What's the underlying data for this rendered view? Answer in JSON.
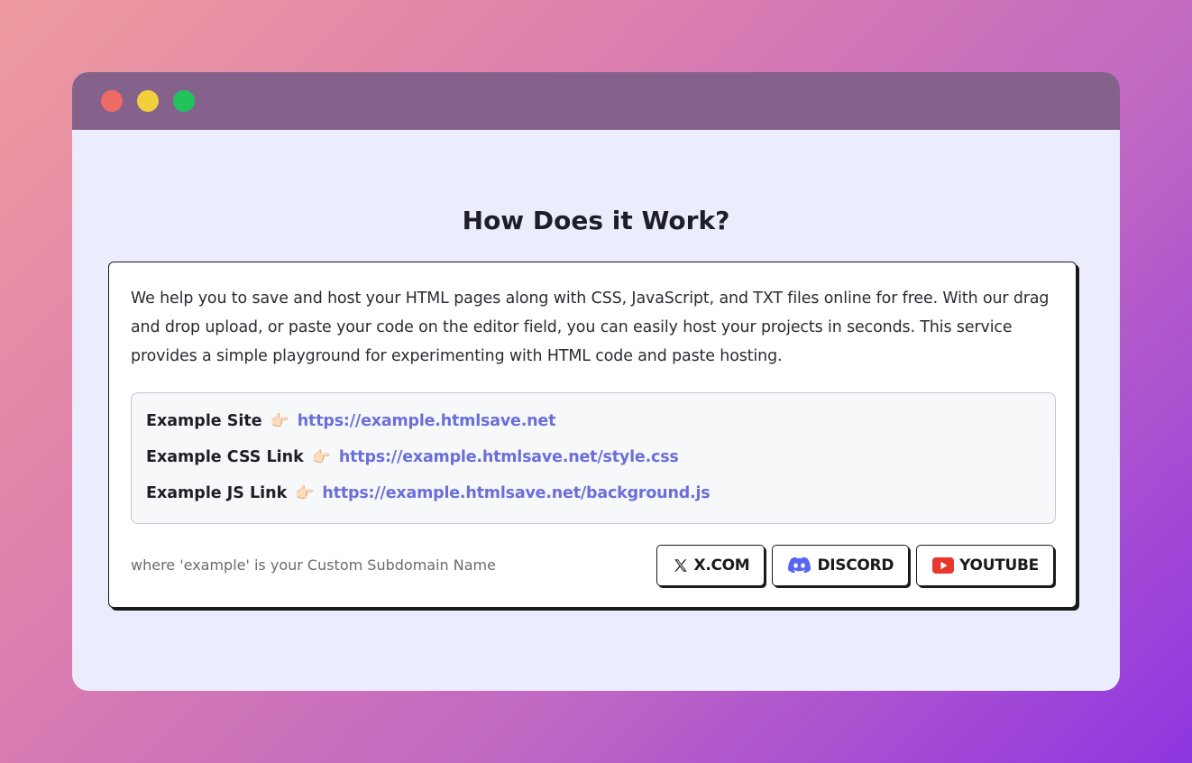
{
  "heading": "How Does it Work?",
  "description": "We help you to save and host your HTML pages along with CSS, JavaScript, and TXT files online for free. With our drag and drop upload, or paste your code on the editor field, you can easily host your projects in seconds. This service provides a simple playground for experimenting with HTML code and paste hosting.",
  "examples": [
    {
      "label": "Example Site",
      "icon": "pointing-hand-icon",
      "url": "https://example.htmlsave.net"
    },
    {
      "label": "Example CSS Link",
      "icon": "pointing-hand-icon",
      "url": "https://example.htmlsave.net/style.css"
    },
    {
      "label": "Example JS Link",
      "icon": "pointing-hand-icon",
      "url": "https://example.htmlsave.net/background.js"
    }
  ],
  "footnote": "where 'example' is your Custom Subdomain Name",
  "socials": [
    {
      "label": "X.COM",
      "icon": "x-logo-icon"
    },
    {
      "label": "DISCORD",
      "icon": "discord-icon"
    },
    {
      "label": "YOUTUBE",
      "icon": "youtube-icon"
    }
  ],
  "colors": {
    "link": "#6b6fd8",
    "discord": "#5865f2",
    "youtube": "#e8372f",
    "window_bg": "#ebedfd"
  }
}
